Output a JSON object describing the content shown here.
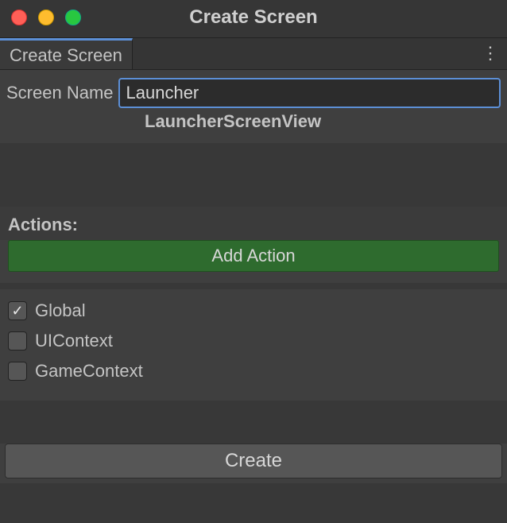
{
  "window": {
    "title": "Create Screen"
  },
  "tab": {
    "label": "Create Screen"
  },
  "form": {
    "screen_name_label": "Screen Name",
    "screen_name_value": "Launcher",
    "generated_hint": "LauncherScreenView"
  },
  "actions": {
    "heading": "Actions:",
    "add_button": "Add Action"
  },
  "contexts": [
    {
      "label": "Global",
      "checked": true
    },
    {
      "label": "UIContext",
      "checked": false
    },
    {
      "label": "GameContext",
      "checked": false
    }
  ],
  "footer": {
    "create_button": "Create"
  },
  "colors": {
    "accent": "#5c8fd6",
    "green_button": "#2e6b2e",
    "bg": "#3f3f3f"
  }
}
